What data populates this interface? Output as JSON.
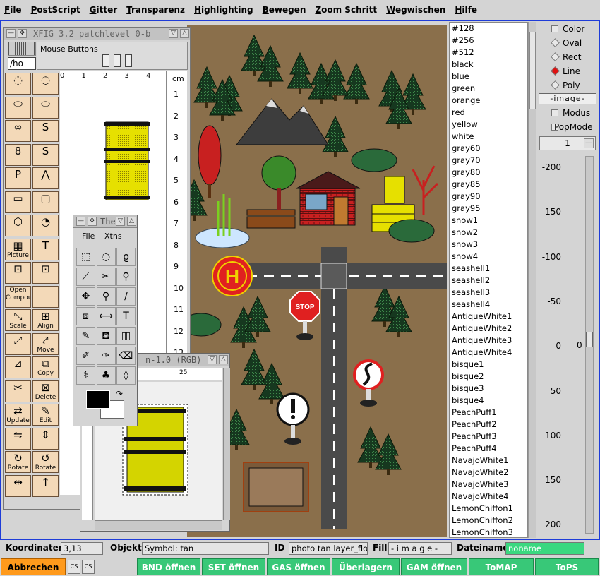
{
  "menu": [
    "File",
    "PostScript",
    "Gitter",
    "Transparenz",
    "Highlighting",
    "Bewegen",
    "Zoom Schritt",
    "Wegwischen",
    "Hilfe"
  ],
  "colors": [
    "#128",
    "#256",
    "#512",
    "black",
    "blue",
    "green",
    "orange",
    "red",
    "yellow",
    "white",
    "gray60",
    "gray70",
    "gray80",
    "gray85",
    "gray90",
    "gray95",
    "snow1",
    "snow2",
    "snow3",
    "snow4",
    "seashell1",
    "seashell2",
    "seashell3",
    "seashell4",
    "AntiqueWhite1",
    "AntiqueWhite2",
    "AntiqueWhite3",
    "AntiqueWhite4",
    "bisque1",
    "bisque2",
    "bisque3",
    "bisque4",
    "PeachPuff1",
    "PeachPuff2",
    "PeachPuff3",
    "PeachPuff4",
    "NavajoWhite1",
    "NavajoWhite2",
    "NavajoWhite3",
    "NavajoWhite4",
    "LemonChiffon1",
    "LemonChiffon2",
    "LemonChiffon3"
  ],
  "right_panel": {
    "options": [
      {
        "label": "Color",
        "type": "check",
        "on": false
      },
      {
        "label": "Oval",
        "type": "radio",
        "on": false
      },
      {
        "label": "Rect",
        "type": "radio",
        "on": false
      },
      {
        "label": "Line",
        "type": "radio",
        "on": true
      },
      {
        "label": "Poly",
        "type": "radio",
        "on": false
      }
    ],
    "image_label": "-image-",
    "modus_label": "Modus",
    "popmode_label": "PopMode",
    "spin_value": "1",
    "scale_ticks": [
      "-200",
      "-150",
      "-100",
      "-50",
      "0",
      "50",
      "100",
      "150",
      "200"
    ],
    "slider_value": "0"
  },
  "xfig": {
    "title": "XFIG 3.2 patchlevel 0-b",
    "mouse_buttons_label": "Mouse Buttons",
    "cmd_text": "/ho",
    "ruler_h": [
      "0",
      "1",
      "2",
      "3",
      "4"
    ],
    "ruler_unit": "cm",
    "ruler_v": [
      "1",
      "2",
      "3",
      "4",
      "5",
      "6",
      "7",
      "8",
      "9",
      "10",
      "11",
      "12",
      "13"
    ],
    "modes": [
      {
        "l": "",
        "g": "◌"
      },
      {
        "l": "",
        "g": "◌"
      },
      {
        "l": "",
        "g": "⬭"
      },
      {
        "l": "",
        "g": "⬭"
      },
      {
        "l": "",
        "g": "∞"
      },
      {
        "l": "",
        "g": "S"
      },
      {
        "l": "",
        "g": "8"
      },
      {
        "l": "",
        "g": "S"
      },
      {
        "l": "",
        "g": "P"
      },
      {
        "l": "",
        "g": "⋀"
      },
      {
        "l": "",
        "g": "▭"
      },
      {
        "l": "",
        "g": "▢"
      },
      {
        "l": "",
        "g": "⬡"
      },
      {
        "l": "",
        "g": "◔"
      },
      {
        "l": "Picture Object",
        "g": "▦"
      },
      {
        "l": "",
        "g": "T"
      },
      {
        "l": "",
        "g": "⊡"
      },
      {
        "l": "",
        "g": "⊡"
      },
      {
        "l": "Open Compound",
        "g": ""
      },
      {
        "l": "",
        "g": ""
      },
      {
        "l": "Scale",
        "g": "⤡"
      },
      {
        "l": "Align",
        "g": "⊞"
      },
      {
        "l": "",
        "g": "⤢"
      },
      {
        "l": "Move",
        "g": "⤤"
      },
      {
        "l": "",
        "g": "⊿"
      },
      {
        "l": "Copy",
        "g": "⧉"
      },
      {
        "l": "",
        "g": "✂"
      },
      {
        "l": "Delete",
        "g": "⊠"
      },
      {
        "l": "Update",
        "g": "⇄"
      },
      {
        "l": "Edit",
        "g": "✎"
      },
      {
        "l": "",
        "g": "⇋"
      },
      {
        "l": "",
        "g": "⇕"
      },
      {
        "l": "Rotate",
        "g": "↻"
      },
      {
        "l": "Rotate",
        "g": "↺"
      },
      {
        "l": "",
        "g": "⇹"
      },
      {
        "l": "",
        "g": "↑"
      }
    ]
  },
  "gimp": {
    "title": "The",
    "menu": [
      "File",
      "Xtns"
    ],
    "tools": [
      "⬚",
      "◌",
      "ϱ",
      "⟋",
      "✂",
      "⚲",
      "✥",
      "⚲",
      "/",
      "⧈",
      "⟷",
      "T",
      "✎",
      "⛾",
      "▥",
      "✐",
      "✑",
      "⌫",
      "⚕",
      "♣",
      "◊"
    ]
  },
  "imgwin": {
    "title": "n-1.0 (RGB)",
    "ruler_mark": "25"
  },
  "status": {
    "koordinaten_label": "Koordinaten",
    "koordinaten_value": "3,13",
    "objekt_label": "Objekt",
    "objekt_value": "Symbol: tan",
    "id_label": "ID",
    "id_value": "photo tan layer_flor",
    "fill_label": "Fill",
    "fill_value": "- i m a g e -",
    "dateiname_label": "Dateiname",
    "dateiname_value": "noname"
  },
  "buttons": {
    "abbrechen": "Abbrechen",
    "bnd": "BND öffnen",
    "set": "SET öffnen",
    "gas": "GAS öffnen",
    "ueberlagern": "Überlagern",
    "gam": "GAM öffnen",
    "tomap": "ToMAP",
    "tops": "ToPS"
  },
  "map_text": {
    "helipad": "H",
    "stop": "STOP"
  }
}
